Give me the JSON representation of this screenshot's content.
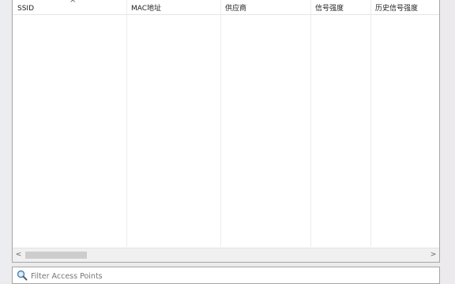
{
  "table": {
    "sort_indicator": "^",
    "columns": [
      "SSID",
      "MAC地址",
      "供应商",
      "信号强度",
      "历史信号强度"
    ],
    "rows": []
  },
  "scrollbar": {
    "left_arrow": "<",
    "right_arrow": ">"
  },
  "filter": {
    "placeholder": "Filter Access Points",
    "value": ""
  }
}
